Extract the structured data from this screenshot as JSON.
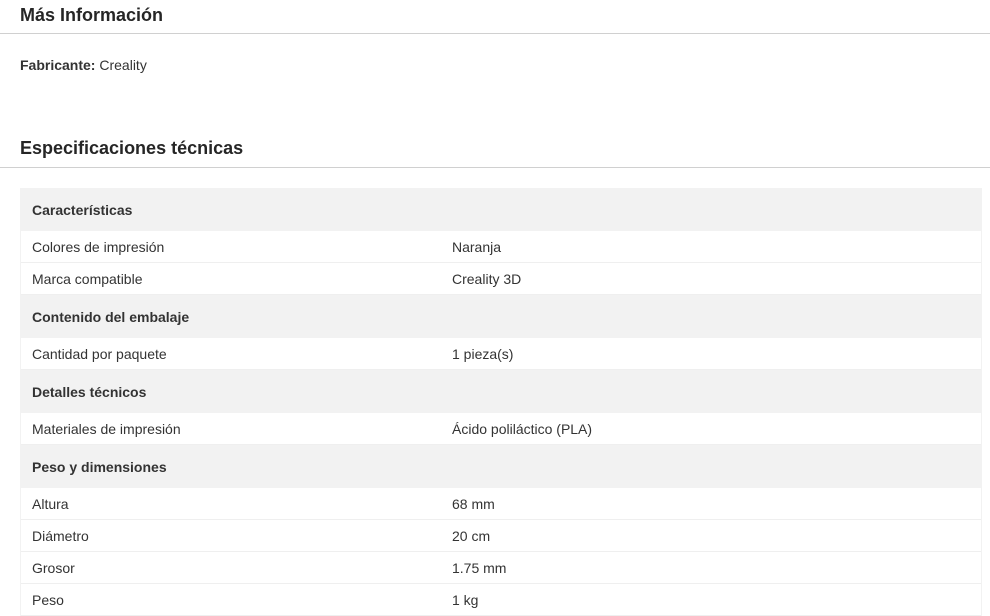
{
  "more_info": {
    "title": "Más Información",
    "manufacturer_label": "Fabricante:",
    "manufacturer_value": "Creality"
  },
  "specs": {
    "title": "Especificaciones técnicas",
    "groups": [
      {
        "name": "Características",
        "rows": [
          {
            "name": "Colores de impresión",
            "value": "Naranja"
          },
          {
            "name": "Marca compatible",
            "value": "Creality 3D"
          }
        ]
      },
      {
        "name": "Contenido del embalaje",
        "rows": [
          {
            "name": "Cantidad por paquete",
            "value": "1 pieza(s)"
          }
        ]
      },
      {
        "name": "Detalles técnicos",
        "rows": [
          {
            "name": "Materiales de impresión",
            "value": "Ácido poliláctico (PLA)"
          }
        ]
      },
      {
        "name": "Peso y dimensiones",
        "rows": [
          {
            "name": "Altura",
            "value": "68 mm"
          },
          {
            "name": "Diámetro",
            "value": "20 cm"
          },
          {
            "name": "Grosor",
            "value": "1.75 mm"
          },
          {
            "name": "Peso",
            "value": "1 kg"
          }
        ]
      }
    ]
  }
}
